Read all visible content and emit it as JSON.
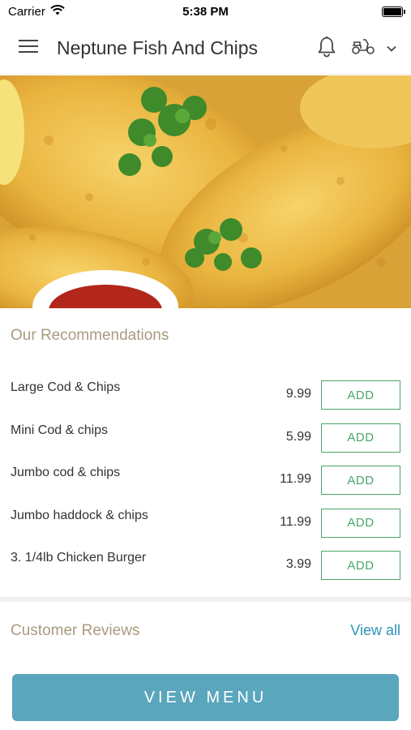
{
  "status_bar": {
    "carrier": "Carrier",
    "time": "5:38 PM"
  },
  "header": {
    "title": "Neptune Fish And Chips",
    "icons": [
      "menu-icon",
      "bell-icon",
      "scooter-icon",
      "chevron-down-icon"
    ]
  },
  "hero": {
    "image": "fried-fish-with-parsley-and-sauce"
  },
  "recommendations": {
    "title": "Our Recommendations",
    "items": [
      {
        "name": "Large Cod & Chips",
        "price": "9.99",
        "add_label": "ADD"
      },
      {
        "name": "Mini Cod & chips",
        "price": "5.99",
        "add_label": "ADD"
      },
      {
        "name": "Jumbo cod & chips",
        "price": "11.99",
        "add_label": "ADD"
      },
      {
        "name": "Jumbo haddock & chips",
        "price": "11.99",
        "add_label": "ADD"
      },
      {
        "name": "3. 1/4lb Chicken Burger",
        "price": "3.99",
        "add_label": "ADD"
      }
    ]
  },
  "reviews": {
    "title": "Customer Reviews",
    "view_all": "View all"
  },
  "footer": {
    "view_menu": "VIEW MENU"
  },
  "colors": {
    "accent_green": "#4aa56a",
    "link_blue": "#2d95b8",
    "section_title": "#a99b7f",
    "view_menu_bg": "#5aa6bd"
  }
}
